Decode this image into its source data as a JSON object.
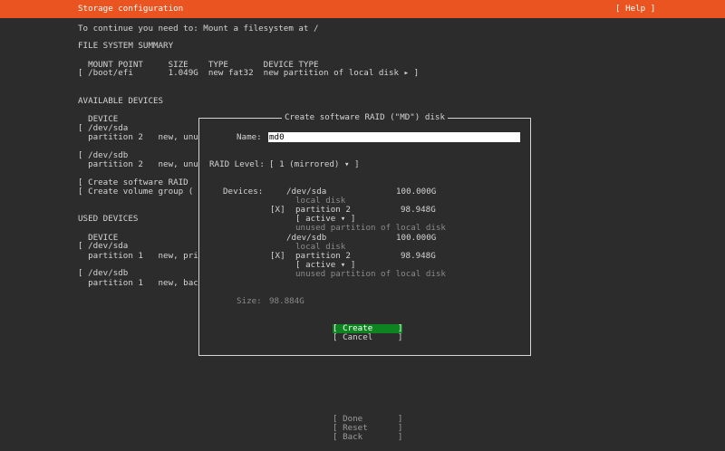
{
  "header": {
    "title": "Storage configuration",
    "help_label": "[ Help ]"
  },
  "main": {
    "instruction": "To continue you need to: Mount a filesystem at /",
    "fs_summary": {
      "heading": "FILE SYSTEM SUMMARY",
      "columns": "  MOUNT POINT     SIZE    TYPE       DEVICE TYPE",
      "row": "[ /boot/efi       1.049G  new fat32  new partition of local disk ▸ ]"
    },
    "available": {
      "heading": "AVAILABLE DEVICES",
      "col_device": "  DEVICE",
      "sda": "[ /dev/sda",
      "sda_part": "  partition 2   new, unu",
      "sdb": "[ /dev/sdb",
      "sdb_part": "  partition 2   new, unu",
      "create_raid": "[ Create software RAID",
      "create_vg": "[ Create volume group ("
    },
    "used": {
      "heading": "USED DEVICES",
      "col_device": "  DEVICE",
      "sda": "[ /dev/sda",
      "sda_part": "  partition 1   new, pri",
      "sdb": "[ /dev/sdb",
      "sdb_part": "  partition 1   new, bac"
    }
  },
  "modal": {
    "title": "Create software RAID (\"MD\") disk",
    "name_label": "Name:",
    "name_value": "md0",
    "raid_level_label": "RAID Level:",
    "raid_level_value": "[ 1 (mirrored) ▾ ]",
    "devices_label": "Devices:",
    "devices": [
      {
        "name": "/dev/sda",
        "size": "100.000G",
        "desc": "local disk",
        "checkbox": "[X]",
        "partition": "partition 2",
        "partition_size": "98.948G",
        "state": "[ active ▾ ]",
        "partition_desc": "unused partition of local disk"
      },
      {
        "name": "/dev/sdb",
        "size": "100.000G",
        "desc": "local disk",
        "checkbox": "[X]",
        "partition": "partition 2",
        "partition_size": "98.948G",
        "state": "[ active ▾ ]",
        "partition_desc": "unused partition of local disk"
      }
    ],
    "size_label": "Size:",
    "size_value": "98.884G",
    "create_label": "[ Create     ]",
    "cancel_label": "[ Cancel     ]"
  },
  "footer": {
    "done_label": "[ Done       ]",
    "reset_label": "[ Reset      ]",
    "back_label": "[ Back       ]"
  },
  "colors": {
    "header_bg": "#e95420",
    "create_bg": "#0e8420",
    "background": "#2c2c2c"
  }
}
